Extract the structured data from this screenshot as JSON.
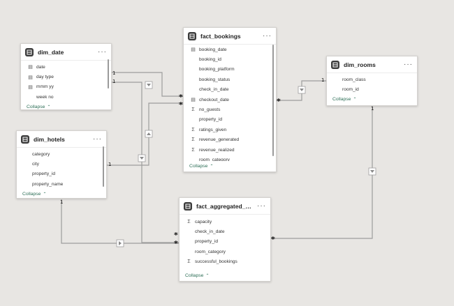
{
  "tables": {
    "dim_date": {
      "title": "dim_date",
      "fields": [
        {
          "icon": "calendar",
          "name": "date"
        },
        {
          "icon": "calendar",
          "name": "day type"
        },
        {
          "icon": "calendar",
          "name": "mmm yy"
        },
        {
          "icon": "none",
          "name": "week no"
        }
      ],
      "collapse": "Collapse"
    },
    "dim_hotels": {
      "title": "dim_hotels",
      "fields": [
        {
          "icon": "none",
          "name": "category"
        },
        {
          "icon": "none",
          "name": "city"
        },
        {
          "icon": "none",
          "name": "property_id"
        },
        {
          "icon": "none",
          "name": "property_name"
        }
      ],
      "collapse": "Collapse"
    },
    "fact_bookings": {
      "title": "fact_bookings",
      "fields": [
        {
          "icon": "calendar",
          "name": "booking_date"
        },
        {
          "icon": "none",
          "name": "booking_id"
        },
        {
          "icon": "none",
          "name": "booking_platform"
        },
        {
          "icon": "none",
          "name": "booking_status"
        },
        {
          "icon": "none",
          "name": "check_in_date"
        },
        {
          "icon": "calendar",
          "name": "checkout_date"
        },
        {
          "icon": "sigma",
          "name": "no_guests"
        },
        {
          "icon": "none",
          "name": "property_id"
        },
        {
          "icon": "sigma",
          "name": "ratings_given"
        },
        {
          "icon": "sigma",
          "name": "revenue_generated"
        },
        {
          "icon": "sigma",
          "name": "revenue_realized"
        },
        {
          "icon": "none",
          "name": "room_category"
        }
      ],
      "collapse": "Collapse"
    },
    "dim_rooms": {
      "title": "dim_rooms",
      "fields": [
        {
          "icon": "none",
          "name": "room_class"
        },
        {
          "icon": "none",
          "name": "room_id"
        }
      ],
      "collapse": "Collapse"
    },
    "fact_aggregated_bookings": {
      "title": "fact_aggregated_booki...",
      "fields": [
        {
          "icon": "sigma",
          "name": "capacity"
        },
        {
          "icon": "none",
          "name": "check_in_date"
        },
        {
          "icon": "none",
          "name": "property_id"
        },
        {
          "icon": "none",
          "name": "room_category"
        },
        {
          "icon": "sigma",
          "name": "successful_bookings"
        }
      ],
      "collapse": "Collapse"
    }
  },
  "cardinality": {
    "one": "1",
    "many": "*"
  },
  "icons": {
    "table": "table-icon",
    "more": "more-options-icon",
    "calendar": "calendar-icon",
    "sigma": "sigma-icon",
    "chevron": "chevron-up-icon",
    "filter_arrow": "filter-direction-icon"
  },
  "colors": {
    "canvas": "#e8e6e3",
    "card": "#ffffff",
    "line": "#9d9d9d",
    "collapse_text": "#2c6e56"
  }
}
